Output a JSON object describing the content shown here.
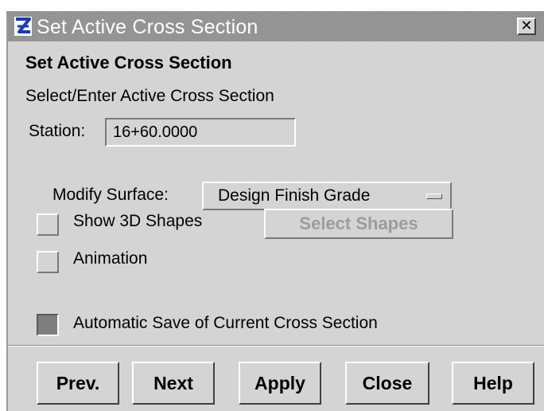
{
  "window": {
    "title": "Set Active Cross Section",
    "close_glyph": "✕"
  },
  "content": {
    "heading": "Set Active Cross Section",
    "subheading": "Select/Enter Active Cross Section",
    "station": {
      "label": "Station:",
      "value": "16+60.0000"
    },
    "surface": {
      "label": "Modify Surface:",
      "selected": "Design Finish Grade"
    },
    "options": {
      "show_3d_shapes": {
        "label": "Show 3D Shapes",
        "checked": false
      },
      "select_shapes_label": "Select Shapes",
      "animation": {
        "label": "Animation",
        "checked": false
      },
      "automatic_save": {
        "label": "Automatic Save of Current Cross Section",
        "checked": true
      }
    }
  },
  "buttons": {
    "prev": "Prev.",
    "next": "Next",
    "apply": "Apply",
    "close": "Close",
    "help": "Help"
  },
  "icons": {
    "app": "app-logo-icon",
    "close": "close-icon",
    "dropdown": "option-menu-indicator-icon"
  },
  "colors": {
    "dialog_bg": "#d4d4d4",
    "titlebar_bg": "#8e8e8e",
    "title_text": "#ffffff",
    "disabled_text": "#9c9c9c",
    "logo_blue": "#1a3bbf"
  }
}
